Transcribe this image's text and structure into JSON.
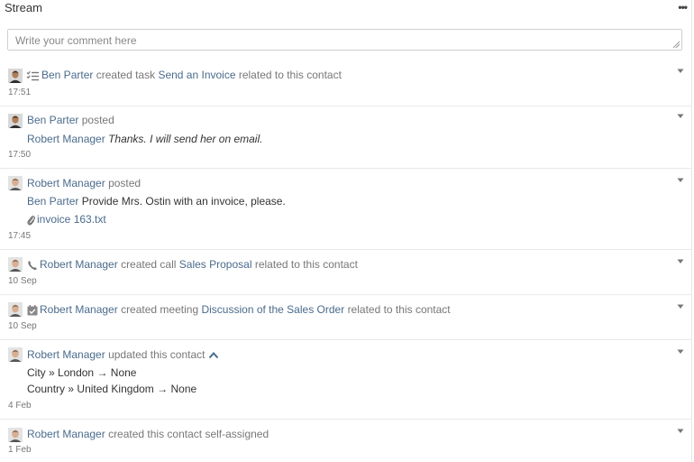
{
  "header": {
    "title": "Stream"
  },
  "comment": {
    "placeholder": "Write your comment here"
  },
  "items": [
    {
      "user": "Ben Parter",
      "action": "created task",
      "target": "Send an Invoice",
      "suffix": "related to this contact",
      "date": "17:51"
    },
    {
      "user": "Ben Parter",
      "action": "posted",
      "mention": "Robert Manager",
      "message": "Thanks. I will send her on email.",
      "date": "17:50"
    },
    {
      "user": "Robert Manager",
      "action": "posted",
      "mention": "Ben Parter",
      "message": "Provide Mrs. Ostin with an invoice, please.",
      "attachment": "invoice 163.txt",
      "date": "17:45"
    },
    {
      "user": "Robert Manager",
      "action": "created call",
      "target": "Sales Proposal",
      "suffix": "related to this contact",
      "date": "10 Sep"
    },
    {
      "user": "Robert Manager",
      "action": "created meeting",
      "target": "Discussion of the Sales Order",
      "suffix": "related to this contact",
      "date": "10 Sep"
    },
    {
      "user": "Robert Manager",
      "action": "updated this contact",
      "changes": [
        {
          "field": "City",
          "sep": "»",
          "from": "London",
          "arrow": "→",
          "to": "None"
        },
        {
          "field": "Country",
          "sep": "»",
          "from": "United Kingdom",
          "arrow": "→",
          "to": "None"
        }
      ],
      "date": "4 Feb"
    },
    {
      "user": "Robert Manager",
      "action": "created this contact self-assigned",
      "date": "1 Feb"
    }
  ]
}
